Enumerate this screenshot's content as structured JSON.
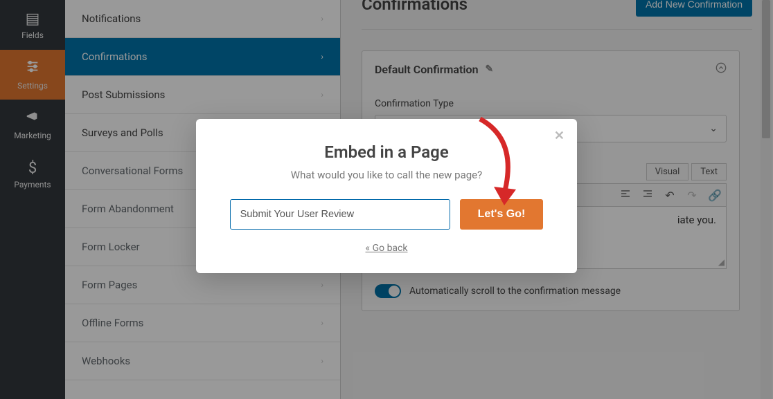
{
  "iconbar": {
    "items": [
      {
        "label": "Fields",
        "active": false
      },
      {
        "label": "Settings",
        "active": true
      },
      {
        "label": "Marketing",
        "active": false
      },
      {
        "label": "Payments",
        "active": false
      }
    ]
  },
  "sidemenu": {
    "items": [
      {
        "label": "Notifications",
        "active": false
      },
      {
        "label": "Confirmations",
        "active": true
      },
      {
        "label": "Post Submissions",
        "active": false
      },
      {
        "label": "Surveys and Polls",
        "active": false
      },
      {
        "label": "Conversational Forms",
        "active": false
      },
      {
        "label": "Form Abandonment",
        "active": false
      },
      {
        "label": "Form Locker",
        "active": false
      },
      {
        "label": "Form Pages",
        "active": false
      },
      {
        "label": "Offline Forms",
        "active": false
      },
      {
        "label": "Webhooks",
        "active": false
      }
    ]
  },
  "page": {
    "title": "Confirmations",
    "add_button": "Add New Confirmation"
  },
  "panel": {
    "title": "Default Confirmation",
    "type_label": "Confirmation Type",
    "tabs": {
      "visual": "Visual",
      "text": "Text"
    },
    "body_text": "iate you.",
    "toggle_label": "Automatically scroll to the confirmation message",
    "toggle_on": true
  },
  "modal": {
    "title": "Embed in a Page",
    "subtitle": "What would you like to call the new page?",
    "input_value": "Submit Your User Review",
    "go": "Let's Go!",
    "back": "« Go back"
  }
}
